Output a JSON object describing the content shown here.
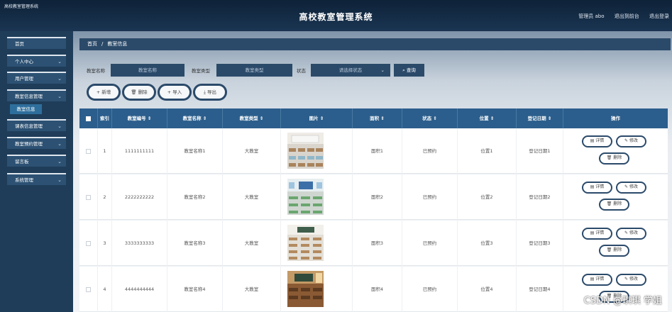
{
  "header": {
    "small_title": "高校教室管理系统",
    "title": "高校教室管理系统",
    "user": "管理员 abo",
    "back_link": "退出到前台",
    "logout": "退出登录"
  },
  "sidebar": {
    "items": [
      {
        "label": "首页",
        "has_arrow": false
      },
      {
        "label": "个人中心",
        "has_arrow": true
      },
      {
        "label": "用户管理",
        "has_arrow": true
      },
      {
        "label": "教室信息管理",
        "has_arrow": true
      },
      {
        "label": "课表信息管理",
        "has_arrow": true
      },
      {
        "label": "教室预约管理",
        "has_arrow": true
      },
      {
        "label": "留言板",
        "has_arrow": true
      },
      {
        "label": "系统管理",
        "has_arrow": true
      }
    ],
    "active_sub": "教室信息"
  },
  "breadcrumb": {
    "home": "首页",
    "sep": "/",
    "current": "教室信息"
  },
  "search": {
    "name_label": "教室名称",
    "name_placeholder": "教室名称",
    "type_label": "教室类型",
    "type_placeholder": "教室类型",
    "status_label": "状态",
    "status_placeholder": "请选择状态",
    "query_button": "查询"
  },
  "actions": {
    "add": "+ 新增",
    "delete": "删除",
    "import": "+ 导入",
    "export": "导出"
  },
  "table": {
    "headers": {
      "index": "索引",
      "number": "教室编号 ⇕",
      "name": "教室名称 ⇕",
      "type": "教室类型 ⇕",
      "image": "图片 ⇕",
      "area": "面积 ⇕",
      "status": "状态 ⇕",
      "location": "位置 ⇕",
      "date": "登记日期 ⇕",
      "ops": "操作"
    },
    "rows": [
      {
        "index": "1",
        "number": "1111111111",
        "name": "教室名称1",
        "type": "大教室",
        "area": "面积1",
        "status": "已预约",
        "location": "位置1",
        "date": "登记日期1"
      },
      {
        "index": "2",
        "number": "2222222222",
        "name": "教室名称2",
        "type": "大教室",
        "area": "面积2",
        "status": "已预约",
        "location": "位置2",
        "date": "登记日期2"
      },
      {
        "index": "3",
        "number": "3333333333",
        "name": "教室名称3",
        "type": "大教室",
        "area": "面积3",
        "status": "已预约",
        "location": "位置3",
        "date": "登记日期3"
      },
      {
        "index": "4",
        "number": "4444444444",
        "name": "教室名称4",
        "type": "大教室",
        "area": "面积4",
        "status": "已预约",
        "location": "位置4",
        "date": "登记日期4"
      }
    ],
    "row_buttons": {
      "detail": "详情",
      "edit": "修改",
      "delete": "删除"
    }
  },
  "watermark": "CSDN @琪琪 学姐",
  "colors": {
    "nav_dark": "#2b4a6a",
    "table_header": "#2b5e8c",
    "sidebar_bg": "#1f3d59"
  }
}
